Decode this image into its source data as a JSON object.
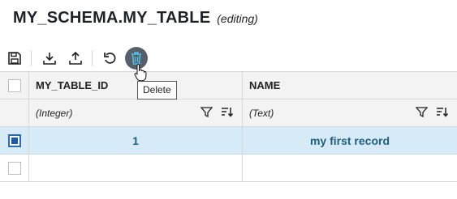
{
  "header": {
    "title": "MY_SCHEMA.MY_TABLE",
    "subtitle": "(editing)"
  },
  "toolbar": {
    "buttons": [
      {
        "icon": "save-icon"
      },
      {
        "icon": "download-icon"
      },
      {
        "icon": "upload-icon"
      },
      {
        "icon": "undo-icon"
      },
      {
        "icon": "delete-icon",
        "state": "hover"
      }
    ],
    "tooltip": "Delete"
  },
  "grid": {
    "columns": [
      {
        "name": "MY_TABLE_ID",
        "type": "(Integer)"
      },
      {
        "name": "NAME",
        "type": "(Text)"
      }
    ],
    "rows": [
      {
        "selected": true,
        "values": [
          "1",
          "my first record"
        ]
      },
      {
        "selected": false,
        "values": [
          "",
          ""
        ]
      }
    ]
  },
  "colors": {
    "selected_row": "#d6eaf8",
    "selected_text": "#1f5f80",
    "header_bg": "#f3f3f3"
  }
}
